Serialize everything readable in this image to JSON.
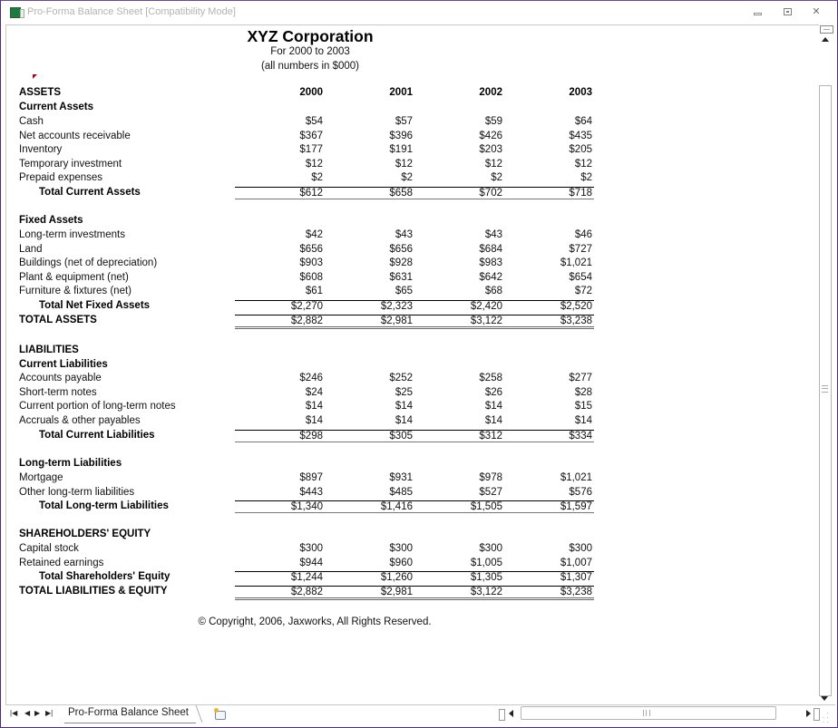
{
  "window": {
    "title": "Pro-Forma Balance Sheet  [Compatibility Mode]",
    "app_icon": "excel-icon",
    "controls": [
      "minimize",
      "restore",
      "close"
    ]
  },
  "header": {
    "company": "XYZ Corporation",
    "period": "For 2000 to 2003",
    "units": "(all numbers in $000)"
  },
  "years": [
    "2000",
    "2001",
    "2002",
    "2003"
  ],
  "sections": {
    "assets_title": "ASSETS",
    "current_assets": {
      "title": "Current Assets",
      "rows": [
        {
          "label": "Cash",
          "values": [
            "$54",
            "$57",
            "$59",
            "$64"
          ]
        },
        {
          "label": "Net accounts receivable",
          "values": [
            "$367",
            "$396",
            "$426",
            "$435"
          ]
        },
        {
          "label": "Inventory",
          "values": [
            "$177",
            "$191",
            "$203",
            "$205"
          ]
        },
        {
          "label": "Temporary investment",
          "values": [
            "$12",
            "$12",
            "$12",
            "$12"
          ]
        },
        {
          "label": "Prepaid expenses",
          "values": [
            "$2",
            "$2",
            "$2",
            "$2"
          ]
        }
      ],
      "total": {
        "label": "Total Current Assets",
        "values": [
          "$612",
          "$658",
          "$702",
          "$718"
        ]
      }
    },
    "fixed_assets": {
      "title": "Fixed Assets",
      "rows": [
        {
          "label": "Long-term investments",
          "values": [
            "$42",
            "$43",
            "$43",
            "$46"
          ]
        },
        {
          "label": "Land",
          "values": [
            "$656",
            "$656",
            "$684",
            "$727"
          ]
        },
        {
          "label": "Buildings (net of depreciation)",
          "values": [
            "$903",
            "$928",
            "$983",
            "$1,021"
          ]
        },
        {
          "label": "Plant & equipment (net)",
          "values": [
            "$608",
            "$631",
            "$642",
            "$654"
          ]
        },
        {
          "label": "Furniture & fixtures (net)",
          "values": [
            "$61",
            "$65",
            "$68",
            "$72"
          ]
        }
      ],
      "total": {
        "label": "Total Net Fixed Assets",
        "values": [
          "$2,270",
          "$2,323",
          "$2,420",
          "$2,520"
        ]
      }
    },
    "total_assets": {
      "label": "TOTAL ASSETS",
      "values": [
        "$2,882",
        "$2,981",
        "$3,122",
        "$3,238"
      ]
    },
    "liabilities_title": "LIABILITIES",
    "current_liabilities": {
      "title": "Current Liabilities",
      "rows": [
        {
          "label": "Accounts payable",
          "values": [
            "$246",
            "$252",
            "$258",
            "$277"
          ]
        },
        {
          "label": "Short-term notes",
          "values": [
            "$24",
            "$25",
            "$26",
            "$28"
          ]
        },
        {
          "label": "Current portion of long-term notes",
          "values": [
            "$14",
            "$14",
            "$14",
            "$15"
          ]
        },
        {
          "label": "Accruals & other payables",
          "values": [
            "$14",
            "$14",
            "$14",
            "$14"
          ]
        }
      ],
      "total": {
        "label": "Total Current Liabilities",
        "values": [
          "$298",
          "$305",
          "$312",
          "$334"
        ]
      }
    },
    "longterm_liabilities": {
      "title": "Long-term Liabilities",
      "rows": [
        {
          "label": "Mortgage",
          "values": [
            "$897",
            "$931",
            "$978",
            "$1,021"
          ]
        },
        {
          "label": "Other long-term liabilities",
          "values": [
            "$443",
            "$485",
            "$527",
            "$576"
          ]
        }
      ],
      "total": {
        "label": "Total Long-term Liabilities",
        "values": [
          "$1,340",
          "$1,416",
          "$1,505",
          "$1,597"
        ]
      }
    },
    "equity": {
      "title": "SHAREHOLDERS' EQUITY",
      "rows": [
        {
          "label": "Capital stock",
          "values": [
            "$300",
            "$300",
            "$300",
            "$300"
          ]
        },
        {
          "label": "Retained earnings",
          "values": [
            "$944",
            "$960",
            "$1,005",
            "$1,007"
          ]
        }
      ],
      "total": {
        "label": "Total Shareholders' Equity",
        "values": [
          "$1,244",
          "$1,260",
          "$1,305",
          "$1,307"
        ]
      }
    },
    "total_liab_equity": {
      "label": "TOTAL LIABILITIES & EQUITY",
      "values": [
        "$2,882",
        "$2,981",
        "$3,122",
        "$3,238"
      ]
    }
  },
  "footer": {
    "copyright": "© Copyright, 2006, Jaxworks, All Rights Reserved."
  },
  "sheet_tabs": {
    "active": "Pro-Forma Balance Sheet",
    "nav": [
      "first-sheet",
      "prev-sheet",
      "next-sheet",
      "last-sheet"
    ]
  }
}
